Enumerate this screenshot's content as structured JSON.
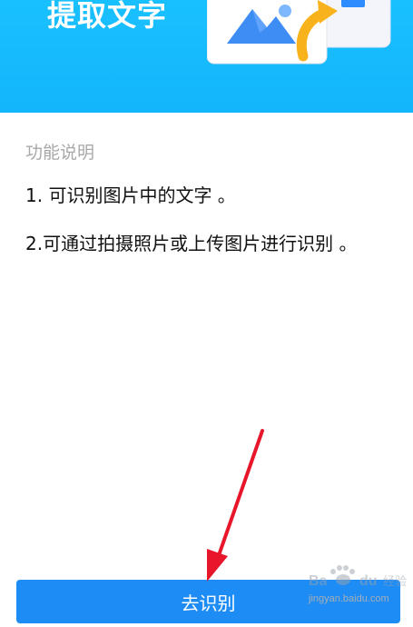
{
  "header": {
    "title": "提取文字"
  },
  "feature": {
    "section_title": "功能说明",
    "lines": [
      "1. 可识别图片中的文字 。",
      "2.可通过拍摄照片或上传图片进行识别 。"
    ]
  },
  "actions": {
    "recognize_label": "去识别"
  },
  "watermark": {
    "brand": "Baidu 经验",
    "url": "jingyan.baidu.com"
  },
  "colors": {
    "header_bg": "#19c0ff",
    "button_bg": "#1e8cf5",
    "arrow": "#e8162b"
  }
}
